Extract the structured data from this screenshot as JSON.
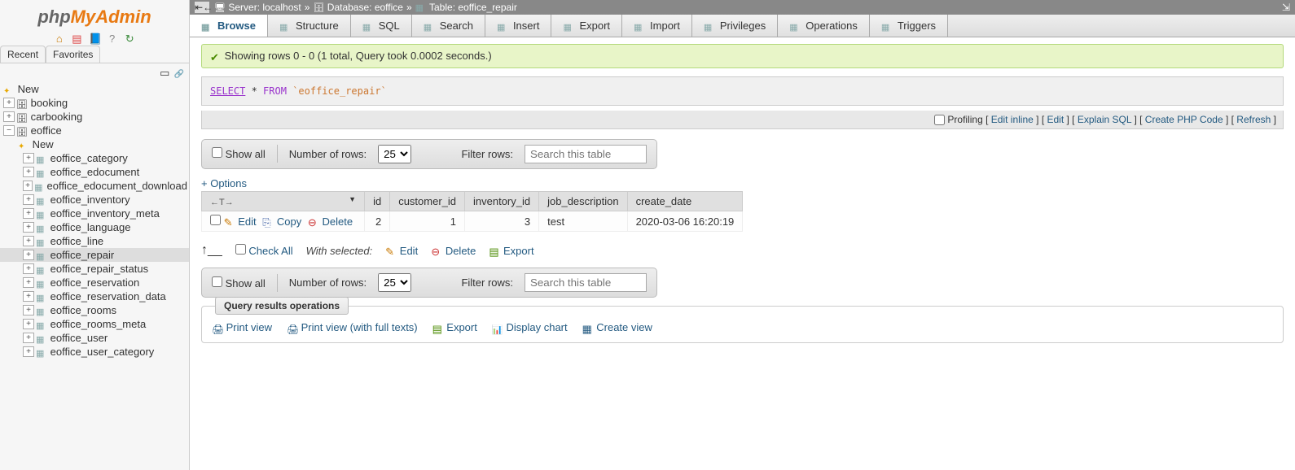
{
  "logo": {
    "php": "php",
    "my": "My",
    "admin": "Admin"
  },
  "sidebar_tabs": {
    "recent": "Recent",
    "favorites": "Favorites"
  },
  "tree": {
    "new": "New",
    "dbs": [
      {
        "name": "booking",
        "expanded": false
      },
      {
        "name": "carbooking",
        "expanded": false
      },
      {
        "name": "eoffice",
        "expanded": true,
        "tables": [
          "eoffice_category",
          "eoffice_edocument",
          "eoffice_edocument_download",
          "eoffice_inventory",
          "eoffice_inventory_meta",
          "eoffice_language",
          "eoffice_line",
          "eoffice_repair",
          "eoffice_repair_status",
          "eoffice_reservation",
          "eoffice_reservation_data",
          "eoffice_rooms",
          "eoffice_rooms_meta",
          "eoffice_user",
          "eoffice_user_category"
        ],
        "selected": "eoffice_repair",
        "new_label": "New"
      }
    ]
  },
  "breadcrumb": {
    "server_lbl": "Server:",
    "server": "localhost",
    "db_lbl": "Database:",
    "db": "eoffice",
    "tbl_lbl": "Table:",
    "tbl": "eoffice_repair",
    "sep": "»"
  },
  "tabs": [
    {
      "key": "browse",
      "label": "Browse",
      "active": true
    },
    {
      "key": "structure",
      "label": "Structure"
    },
    {
      "key": "sql",
      "label": "SQL"
    },
    {
      "key": "search",
      "label": "Search"
    },
    {
      "key": "insert",
      "label": "Insert"
    },
    {
      "key": "export",
      "label": "Export"
    },
    {
      "key": "import",
      "label": "Import"
    },
    {
      "key": "privileges",
      "label": "Privileges"
    },
    {
      "key": "operations",
      "label": "Operations"
    },
    {
      "key": "triggers",
      "label": "Triggers"
    }
  ],
  "success_msg": "Showing rows 0 - 0 (1 total, Query took 0.0002 seconds.)",
  "sql": {
    "select": "SELECT",
    "star": " * ",
    "from": "FROM",
    "table": "`eoffice_repair`"
  },
  "sql_actions": {
    "profiling": "Profiling",
    "edit_inline": "Edit inline",
    "edit": "Edit",
    "explain": "Explain SQL",
    "php": "Create PHP Code",
    "refresh": "Refresh"
  },
  "controls": {
    "show_all": "Show all",
    "num_rows": "Number of rows:",
    "filter": "Filter rows:",
    "placeholder": "Search this table",
    "rows_value": "25"
  },
  "options_label": "+ Options",
  "columns": [
    "id",
    "customer_id",
    "inventory_id",
    "job_description",
    "create_date"
  ],
  "row_actions": {
    "edit": "Edit",
    "copy": "Copy",
    "delete": "Delete"
  },
  "rows": [
    {
      "id": "2",
      "customer_id": "1",
      "inventory_id": "3",
      "job_description": "test",
      "create_date": "2020-03-06 16:20:19"
    }
  ],
  "with_selected": {
    "check_all": "Check All",
    "label": "With selected:",
    "edit": "Edit",
    "delete": "Delete",
    "export": "Export"
  },
  "ops": {
    "legend": "Query results operations",
    "print": "Print view",
    "print_full": "Print view (with full texts)",
    "export": "Export",
    "chart": "Display chart",
    "create_view": "Create view"
  }
}
